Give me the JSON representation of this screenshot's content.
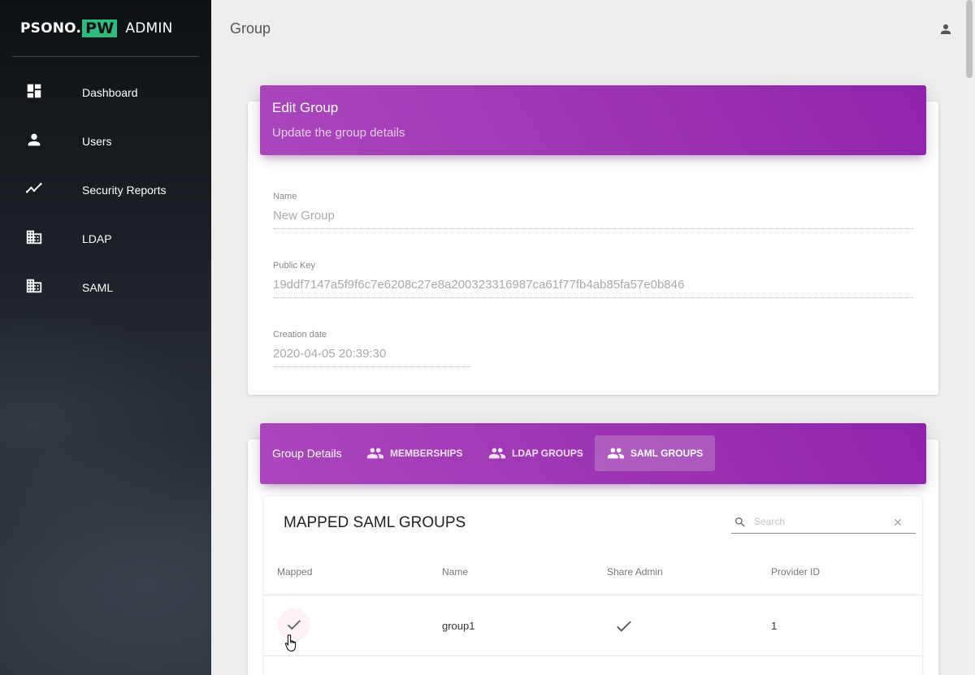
{
  "brand": {
    "part1": "PSONO.",
    "part2": "PW",
    "part3": "ADMIN"
  },
  "sidebar": {
    "items": [
      {
        "label": "Dashboard",
        "icon": "dashboard-icon"
      },
      {
        "label": "Users",
        "icon": "person-icon"
      },
      {
        "label": "Security Reports",
        "icon": "timeline-icon"
      },
      {
        "label": "LDAP",
        "icon": "building-icon"
      },
      {
        "label": "SAML",
        "icon": "building-icon"
      }
    ]
  },
  "header": {
    "title": "Group",
    "user_icon": "person-icon"
  },
  "edit_card": {
    "title": "Edit Group",
    "subtitle": "Update the group details",
    "fields": [
      {
        "label": "Name",
        "value": "New Group"
      },
      {
        "label": "Public Key",
        "value": "19ddf7147a5f9f6c7e6208c27e8a200323316987ca61f77fb4ab85fa57e0b846"
      },
      {
        "label": "Creation date",
        "value": "2020-04-05 20:39:30"
      }
    ]
  },
  "details_card": {
    "title": "Group Details",
    "tabs": [
      {
        "label": "MEMBERSHIPS",
        "icon": "group-icon",
        "active": false
      },
      {
        "label": "LDAP GROUPS",
        "icon": "group-icon",
        "active": false
      },
      {
        "label": "SAML GROUPS",
        "icon": "group-icon",
        "active": true
      }
    ]
  },
  "saml_table": {
    "title": "MAPPED SAML GROUPS",
    "search": {
      "placeholder": "Search",
      "value": ""
    },
    "columns": [
      "Mapped",
      "Name",
      "Share Admin",
      "Provider ID"
    ],
    "rows": [
      {
        "mapped": true,
        "name": "group1",
        "share_admin": true,
        "provider_id": "1"
      }
    ]
  },
  "colors": {
    "accent": "#9c27b0",
    "brand_green": "#2dbb7f"
  }
}
